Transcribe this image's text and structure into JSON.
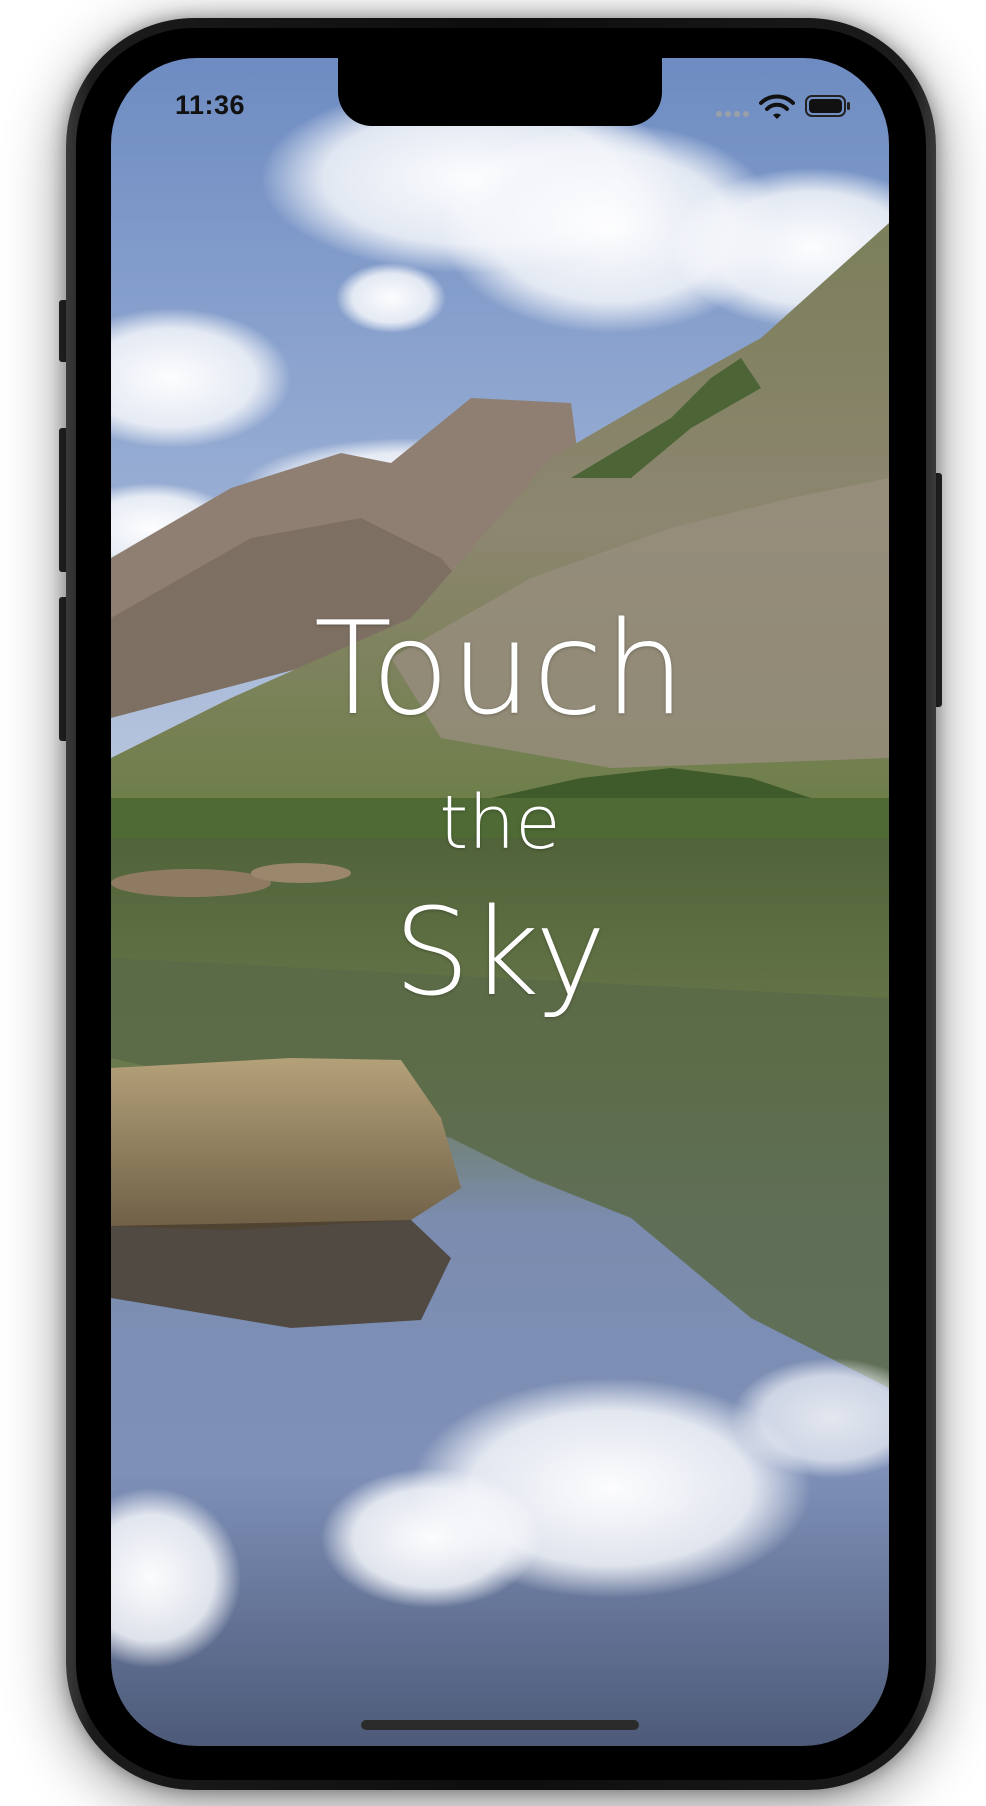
{
  "status_bar": {
    "time": "11:36"
  },
  "hero": {
    "line1": "Touch",
    "line2": "the",
    "line3": "Sky"
  },
  "colors": {
    "title_text": "#ffffff",
    "device_frame": "#111111",
    "sky": "#7c97c7",
    "water": "#5d6f92",
    "grass": "#5f7b43"
  },
  "icons": [
    "signal-icon",
    "wifi-icon",
    "battery-icon"
  ]
}
